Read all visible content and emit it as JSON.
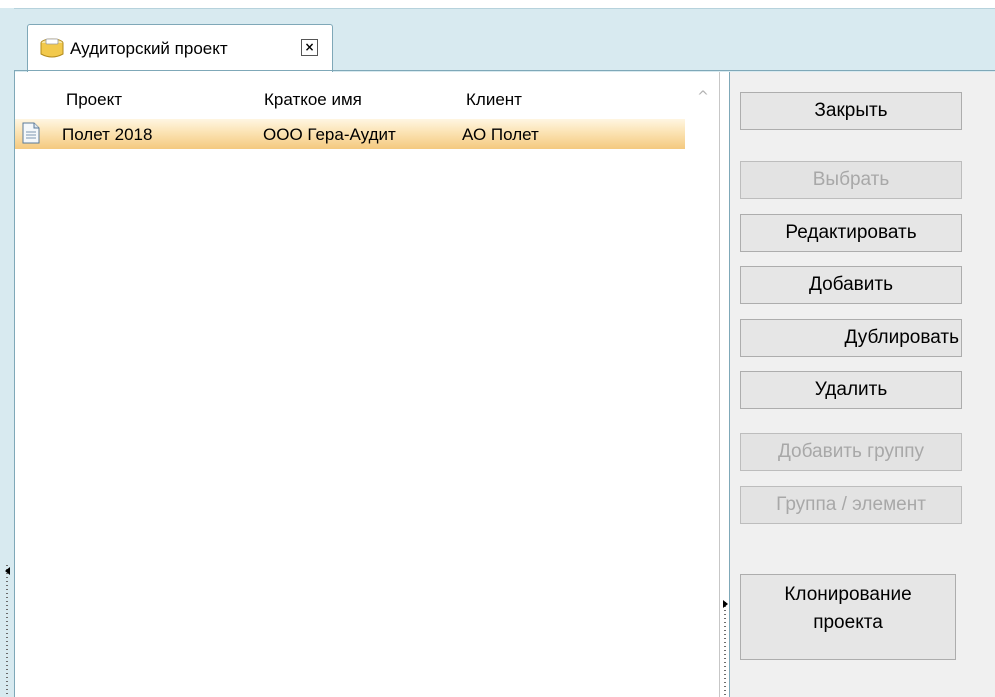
{
  "tab": {
    "title": "Аудиторский проект",
    "close_glyph": "×",
    "icon": "folder-db-icon"
  },
  "grid": {
    "columns": [
      "Проект",
      "Краткое имя",
      "Клиент"
    ],
    "rows": [
      {
        "project": "Полет 2018",
        "short_name": "ООО Гера-Аудит",
        "client": "АО Полет",
        "icon": "document-icon"
      }
    ],
    "scroll_up_glyph": "^"
  },
  "buttons": {
    "close": "Закрыть",
    "select": "Выбрать",
    "edit": "Редактировать",
    "add": "Добавить",
    "duplicate": "Дублировать",
    "delete": "Удалить",
    "add_group": "Добавить группу",
    "group_element": "Группа / элемент",
    "clone_project_line1": "Клонирование",
    "clone_project_line2": "проекта"
  },
  "colors": {
    "tabbar_bg": "#d8eaf0",
    "row_highlight": "#f4c97f",
    "disabled_text": "#a8a8a8"
  }
}
